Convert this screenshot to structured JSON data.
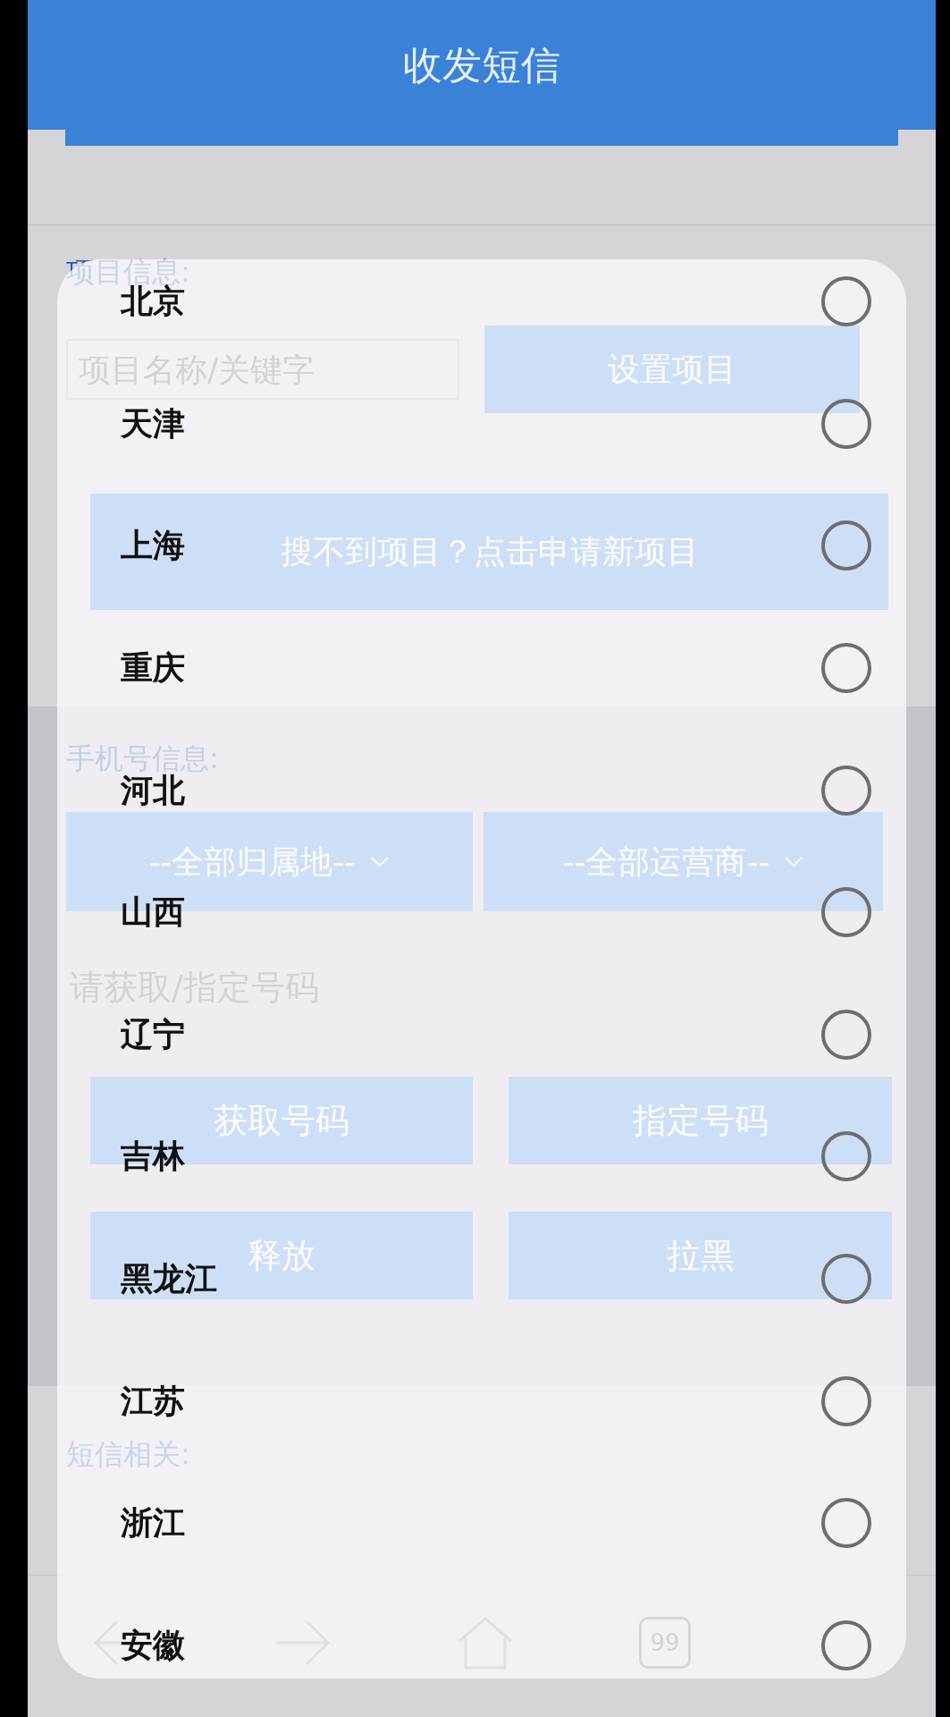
{
  "header": {
    "title": "收发短信"
  },
  "project_section": {
    "label": "项目信息:",
    "search": {
      "placeholder": "项目名称/关键字"
    },
    "set_button": "设置项目",
    "apply_button": "搜不到项目？点击申请新项目"
  },
  "phone_section": {
    "label": "手机号信息:",
    "region_select": "--全部归属地--",
    "carrier_select": "--全部运营商--",
    "number_field": {
      "placeholder": "请获取/指定号码"
    },
    "buttons": [
      "获取号码",
      "指定号码",
      "释放",
      "拉黑"
    ]
  },
  "sms_section": {
    "label": "短信相关:"
  },
  "nav_bar": {
    "badge": "99"
  },
  "province_dialog": {
    "items": [
      {
        "label": "北京",
        "selected": false
      },
      {
        "label": "天津",
        "selected": false
      },
      {
        "label": "上海",
        "selected": false
      },
      {
        "label": "重庆",
        "selected": false
      },
      {
        "label": "河北",
        "selected": false
      },
      {
        "label": "山西",
        "selected": false
      },
      {
        "label": "辽宁",
        "selected": false
      },
      {
        "label": "吉林",
        "selected": false
      },
      {
        "label": "黑龙江",
        "selected": false
      },
      {
        "label": "江苏",
        "selected": false
      },
      {
        "label": "浙江",
        "selected": false
      },
      {
        "label": "安徽",
        "selected": false
      }
    ]
  }
}
